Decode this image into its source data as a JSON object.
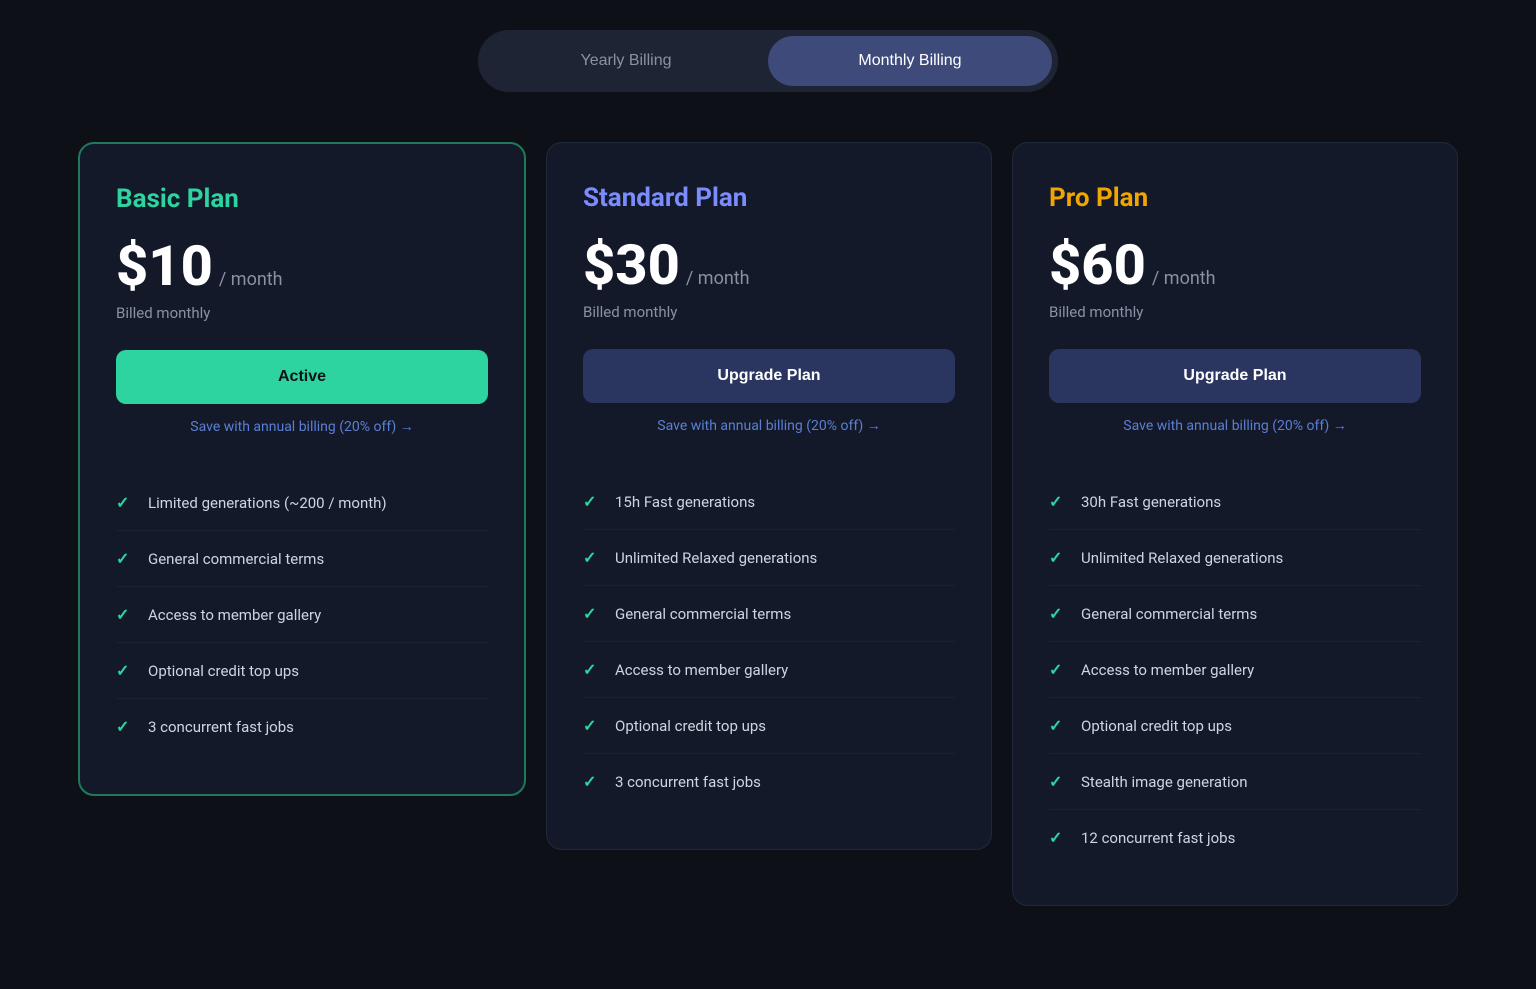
{
  "toggle": {
    "yearly_label": "Yearly Billing",
    "monthly_label": "Monthly Billing"
  },
  "plans": [
    {
      "id": "basic",
      "name": "Basic Plan",
      "name_class": "basic",
      "price": "$10",
      "period": "/ month",
      "billed": "Billed monthly",
      "action_label": "Active",
      "action_type": "active",
      "save_link": "Save with annual billing (20% off) →",
      "features": [
        "Limited generations (~200 / month)",
        "General commercial terms",
        "Access to member gallery",
        "Optional credit top ups",
        "3 concurrent fast jobs"
      ]
    },
    {
      "id": "standard",
      "name": "Standard Plan",
      "name_class": "standard",
      "price": "$30",
      "period": "/ month",
      "billed": "Billed monthly",
      "action_label": "Upgrade Plan",
      "action_type": "upgrade",
      "save_link": "Save with annual billing (20% off) →",
      "features": [
        "15h Fast generations",
        "Unlimited Relaxed generations",
        "General commercial terms",
        "Access to member gallery",
        "Optional credit top ups",
        "3 concurrent fast jobs"
      ]
    },
    {
      "id": "pro",
      "name": "Pro Plan",
      "name_class": "pro",
      "price": "$60",
      "period": "/ month",
      "billed": "Billed monthly",
      "action_label": "Upgrade Plan",
      "action_type": "upgrade",
      "save_link": "Save with annual billing (20% off) →",
      "features": [
        "30h Fast generations",
        "Unlimited Relaxed generations",
        "General commercial terms",
        "Access to member gallery",
        "Optional credit top ups",
        "Stealth image generation",
        "12 concurrent fast jobs"
      ]
    }
  ],
  "check_symbol": "✓"
}
